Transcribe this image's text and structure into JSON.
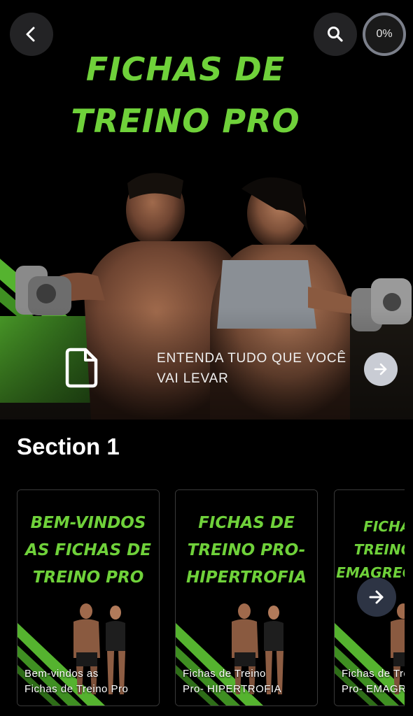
{
  "header": {
    "back_icon": "chevron-left-icon",
    "search_icon": "search-icon",
    "progress_percent": 0,
    "progress_label": "0%"
  },
  "hero": {
    "title_line1": "FICHAS DE",
    "title_line2": "TREINO PRO",
    "intro_icon": "document-icon",
    "intro_text_line1": "ENTENDA TUDO QUE VOCÊ",
    "intro_text_line2": "VAI LEVAR",
    "intro_arrow_icon": "arrow-right-icon"
  },
  "section": {
    "title": "Section 1",
    "next_icon": "arrow-right-icon",
    "cards": [
      {
        "cover_lines": [
          "BEM-VINDOS",
          "AS FICHAS DE",
          "TREINO PRO"
        ],
        "caption_line1": "Bem-vindos as",
        "caption_line2": "Fichas de Treino Pro"
      },
      {
        "cover_lines": [
          "FICHAS DE",
          "TREINO PRO-",
          "HIPERTROFIA"
        ],
        "caption_line1": "Fichas de Treino",
        "caption_line2": "Pro- HIPERTROFIA"
      },
      {
        "cover_lines": [
          "FICHAS DE",
          "TREINO PRO-",
          "EMAGRECIMENTO"
        ],
        "caption_line1": "Fichas de Treino",
        "caption_line2": "Pro- EMAGRECIMENTO"
      }
    ]
  },
  "colors": {
    "accent_green": "#6fd13a",
    "background": "#000000",
    "button_dark": "#262628",
    "next_button": "#2d3444"
  }
}
